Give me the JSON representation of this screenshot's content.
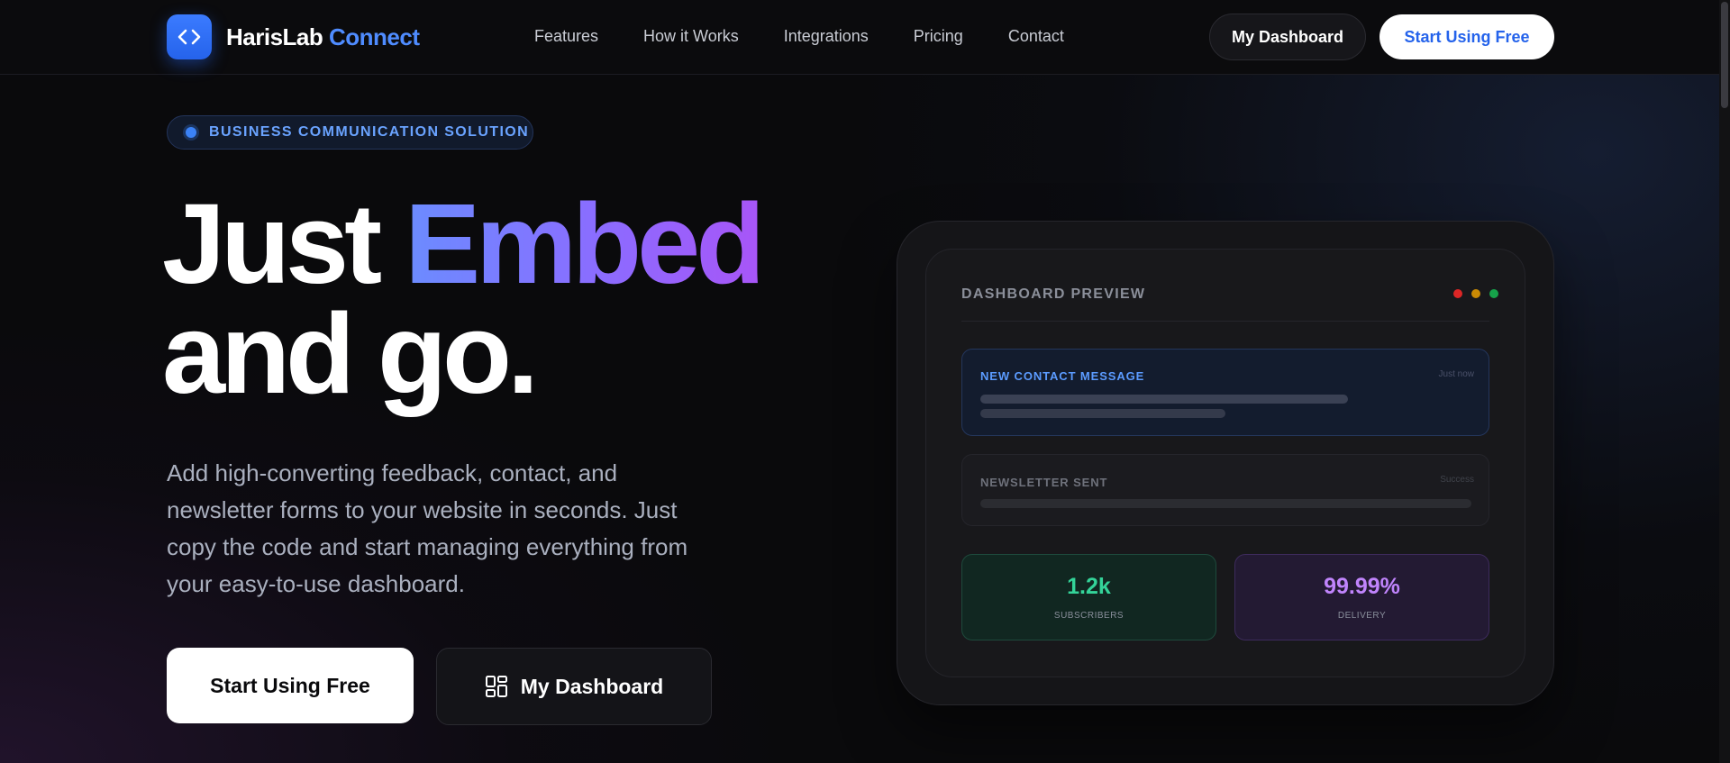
{
  "nav": {
    "brand_main": "HarisLab",
    "brand_accent": "Connect",
    "links": [
      "Features",
      "How it Works",
      "Integrations",
      "Pricing",
      "Contact"
    ],
    "dashboard_button": "My Dashboard",
    "start_button": "Start Using Free"
  },
  "hero": {
    "badge": "BUSINESS COMMUNICATION SOLUTION",
    "headline_line1_plain": "Just",
    "headline_line1_accent": "Embed",
    "headline_line2": "and go.",
    "description": "Add high-converting feedback, contact, and newsletter forms to your website in seconds. Just copy the code and start managing everything from your easy-to-use dashboard.",
    "primary_button": "Start Using Free",
    "secondary_button": "My Dashboard"
  },
  "preview": {
    "title": "DASHBOARD PREVIEW",
    "window_dot_colors": [
      "#ef4444",
      "#eab308",
      "#22c55e"
    ],
    "message_card": {
      "label": "NEW CONTACT MESSAGE",
      "time": "Just now"
    },
    "newsletter_card": {
      "label": "NEWSLETTER SENT",
      "status": "Success"
    },
    "stats": [
      {
        "value": "1.2k",
        "label": "SUBSCRIBERS",
        "color": "#34d399"
      },
      {
        "value": "99.99%",
        "label": "DELIVERY",
        "color": "#c084fc"
      }
    ]
  },
  "colors": {
    "accent_blue": "#2563eb",
    "brand_accent": "#4f8cff",
    "background": "#0a0a0c"
  }
}
